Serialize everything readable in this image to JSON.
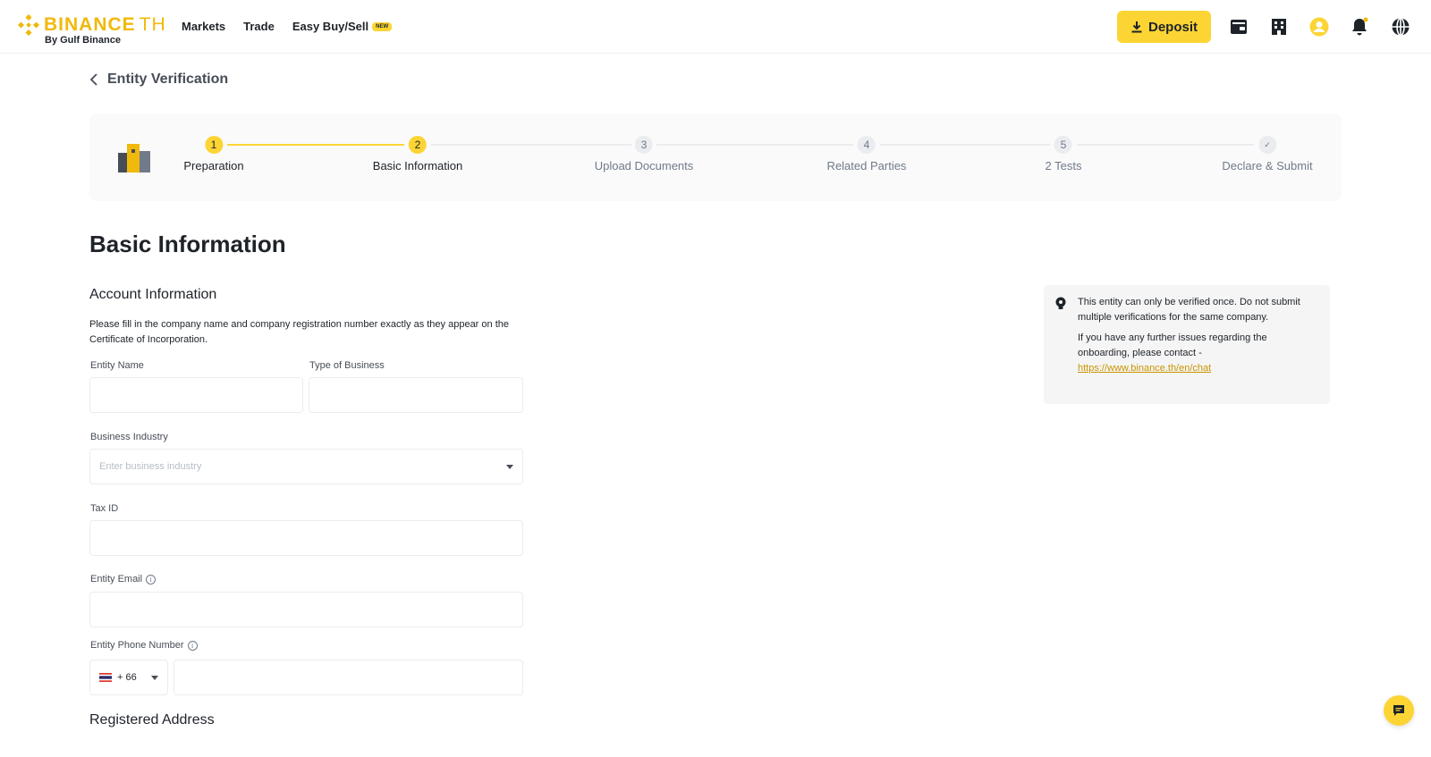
{
  "header": {
    "logo": {
      "brand": "BINANCE",
      "suffix": "TH",
      "sub": "By Gulf Binance"
    },
    "nav": [
      {
        "label": "Markets"
      },
      {
        "label": "Trade"
      },
      {
        "label": "Easy Buy/Sell",
        "badge": "NEW"
      }
    ],
    "deposit_label": "Deposit",
    "icons": [
      "wallet-icon",
      "building-icon",
      "user-avatar-icon",
      "bell-icon",
      "globe-icon"
    ],
    "accent_color": "#FCD535"
  },
  "page": {
    "title": "Entity Verification"
  },
  "stepper": {
    "steps": [
      {
        "num": "1",
        "label": "Preparation",
        "state": "active"
      },
      {
        "num": "2",
        "label": "Basic Information",
        "state": "active"
      },
      {
        "num": "3",
        "label": "Upload Documents",
        "state": "todo"
      },
      {
        "num": "4",
        "label": "Related Parties",
        "state": "todo"
      },
      {
        "num": "5",
        "label": "2 Tests",
        "state": "todo"
      },
      {
        "num": "✓",
        "label": "Declare & Submit",
        "state": "todo"
      }
    ]
  },
  "form": {
    "heading": "Basic Information",
    "account_section": "Account Information",
    "description": "Please fill in the company name and company registration number exactly as they appear on the Certificate of Incorporation.",
    "entity_name": {
      "label": "Entity Name",
      "value": ""
    },
    "type_of_business": {
      "label": "Type of Business",
      "value": ""
    },
    "business_industry": {
      "label": "Business Industry",
      "placeholder": "Enter business industry"
    },
    "tax_id": {
      "label": "Tax ID",
      "value": ""
    },
    "entity_email": {
      "label": "Entity Email",
      "value": ""
    },
    "entity_phone": {
      "label": "Entity Phone Number",
      "country_code": "+ 66",
      "value": ""
    },
    "registered_address_section": "Registered Address"
  },
  "info_box": {
    "line1": "This entity can only be verified once. Do not submit multiple verifications for the same company.",
    "line2": "If you have any further issues regarding the onboarding, please contact -",
    "link": "https://www.binance.th/en/chat"
  }
}
